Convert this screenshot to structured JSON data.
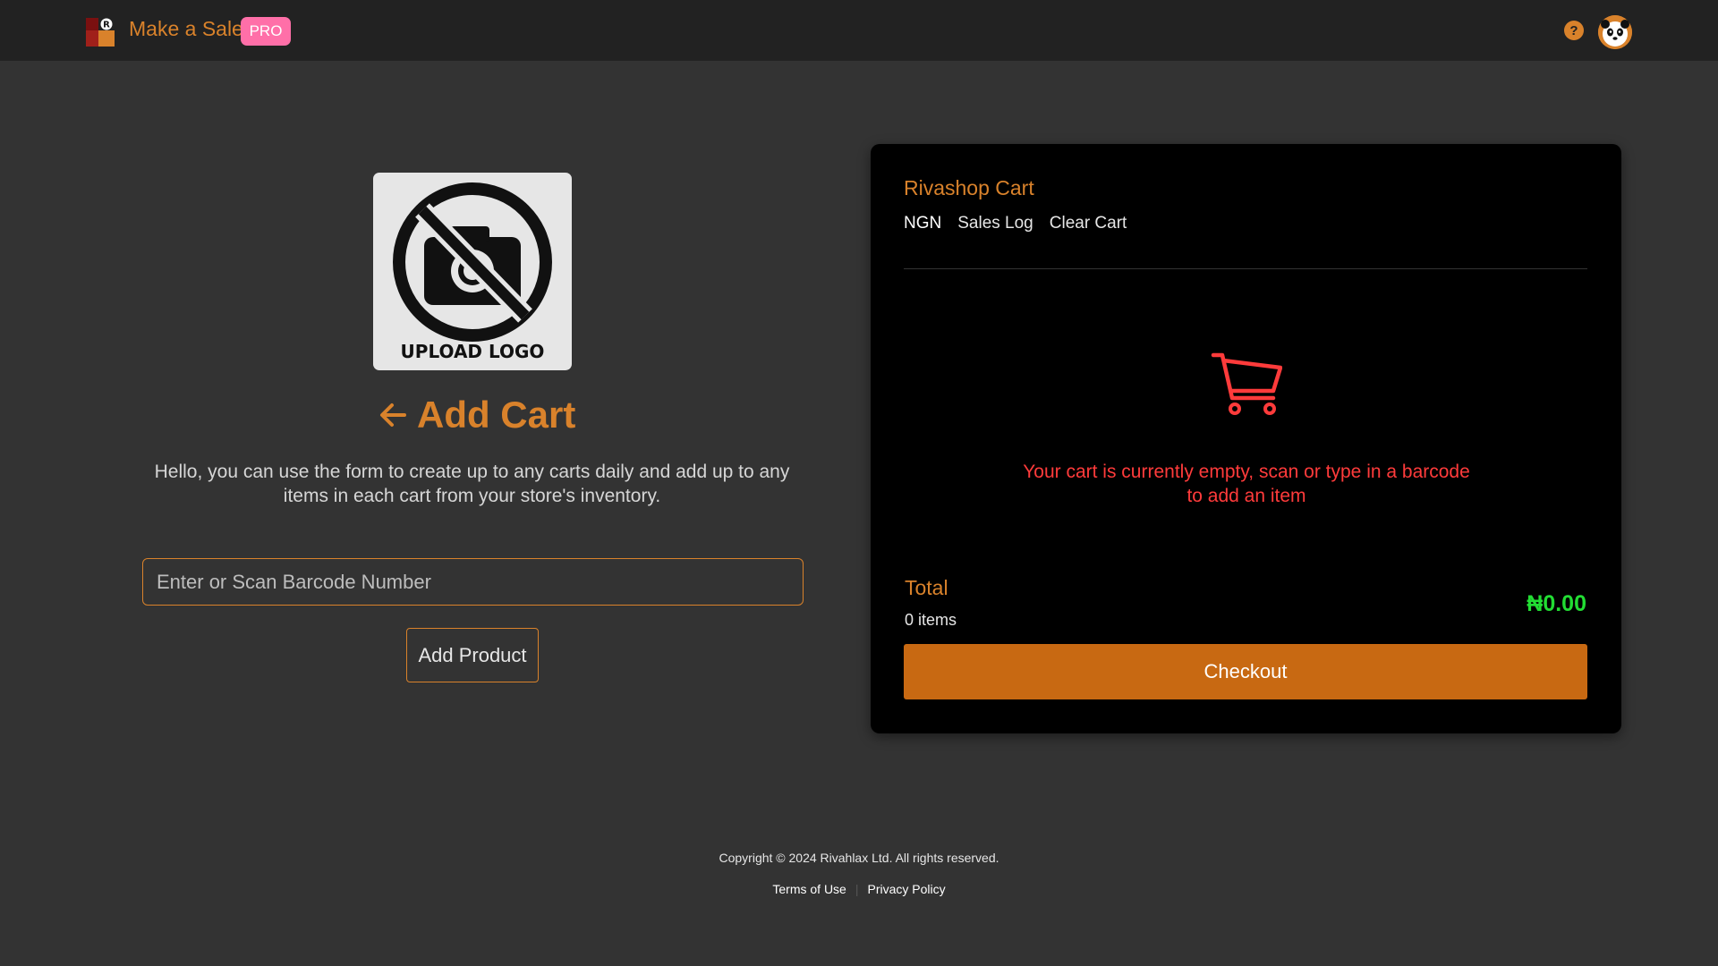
{
  "header": {
    "app_title": "Make a Sale",
    "badge": "PRO",
    "help_symbol": "?",
    "brand_logo_letter": "R"
  },
  "logo_uploader": {
    "label": "UPLOAD LOGO",
    "icon": "no-camera-icon"
  },
  "main": {
    "title": "Add Cart",
    "intro": "Hello, you can use the form to create up to any carts daily and add up to any items in each cart from your store's inventory.",
    "barcode_placeholder": "Enter or Scan Barcode Number",
    "barcode_value": "",
    "add_product_label": "Add Product"
  },
  "cart": {
    "title": "Rivashop Cart",
    "nav": [
      "NGN",
      "Sales Log",
      "Clear Cart"
    ],
    "empty_message": "Your cart is currently empty, scan or type in a barcode to add an item",
    "total_label": "Total",
    "items_count": "0 items",
    "total_amount": "₦0.00",
    "checkout_label": "Checkout"
  },
  "footer": {
    "copyright": "Copyright © 2024 Rivahlax Ltd. All rights reserved.",
    "links": [
      "Terms of Use",
      "Privacy Policy"
    ]
  },
  "colors": {
    "accent": "#d9822b",
    "checkout": "#c86912",
    "pro_badge": "#ff6fa8",
    "empty_message": "#ff3b3b",
    "total_amount": "#22dd33",
    "background": "#333333",
    "topbar": "#222222",
    "panel": "#000000"
  }
}
